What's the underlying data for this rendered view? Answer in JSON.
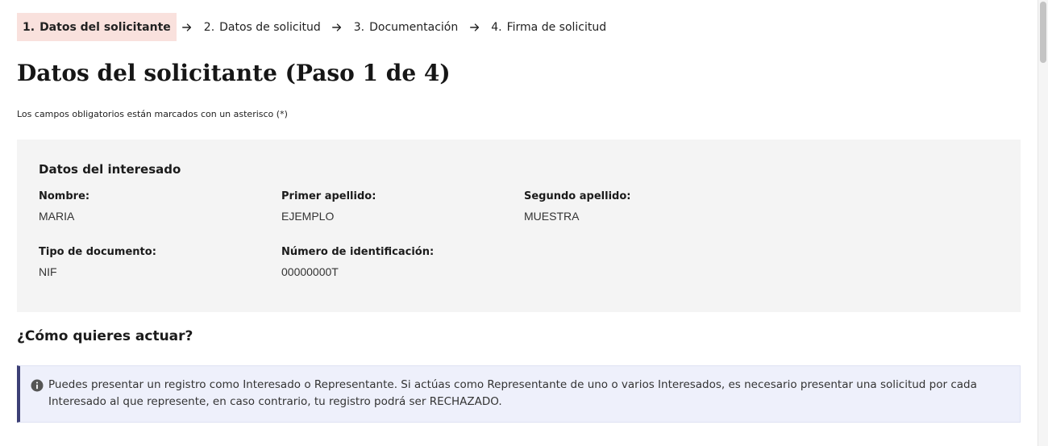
{
  "stepper": {
    "steps": [
      {
        "number": "1.",
        "label": "Datos del solicitante",
        "active": true
      },
      {
        "number": "2.",
        "label": "Datos de solicitud",
        "active": false
      },
      {
        "number": "3.",
        "label": "Documentación",
        "active": false
      },
      {
        "number": "4.",
        "label": "Firma de solicitud",
        "active": false
      }
    ]
  },
  "page": {
    "title": "Datos del solicitante (Paso 1 de 4)",
    "required_note": "Los campos obligatorios están marcados con un asterisco (*)"
  },
  "interesado": {
    "title": "Datos del interesado",
    "fields": [
      {
        "label": "Nombre:",
        "value": "MARIA"
      },
      {
        "label": "Primer apellido:",
        "value": "EJEMPLO"
      },
      {
        "label": "Segundo apellido:",
        "value": "MUESTRA"
      },
      {
        "label": "Tipo de documento:",
        "value": "NIF"
      },
      {
        "label": "Número de identificación:",
        "value": "00000000T"
      }
    ]
  },
  "actuar": {
    "title": "¿Cómo quieres actuar?",
    "info": "Puedes presentar un registro como Interesado o Representante. Si actúas como Representante de uno o varios Interesados, es necesario presentar una solicitud por cada Interesado al que represente, en caso contrario, tu registro podrá ser RECHAZADO."
  },
  "colors": {
    "active_step_bg": "#f9e1dd",
    "card_bg": "#f4f4f4",
    "info_bg": "#eef0fb",
    "info_border": "#3d4076"
  }
}
